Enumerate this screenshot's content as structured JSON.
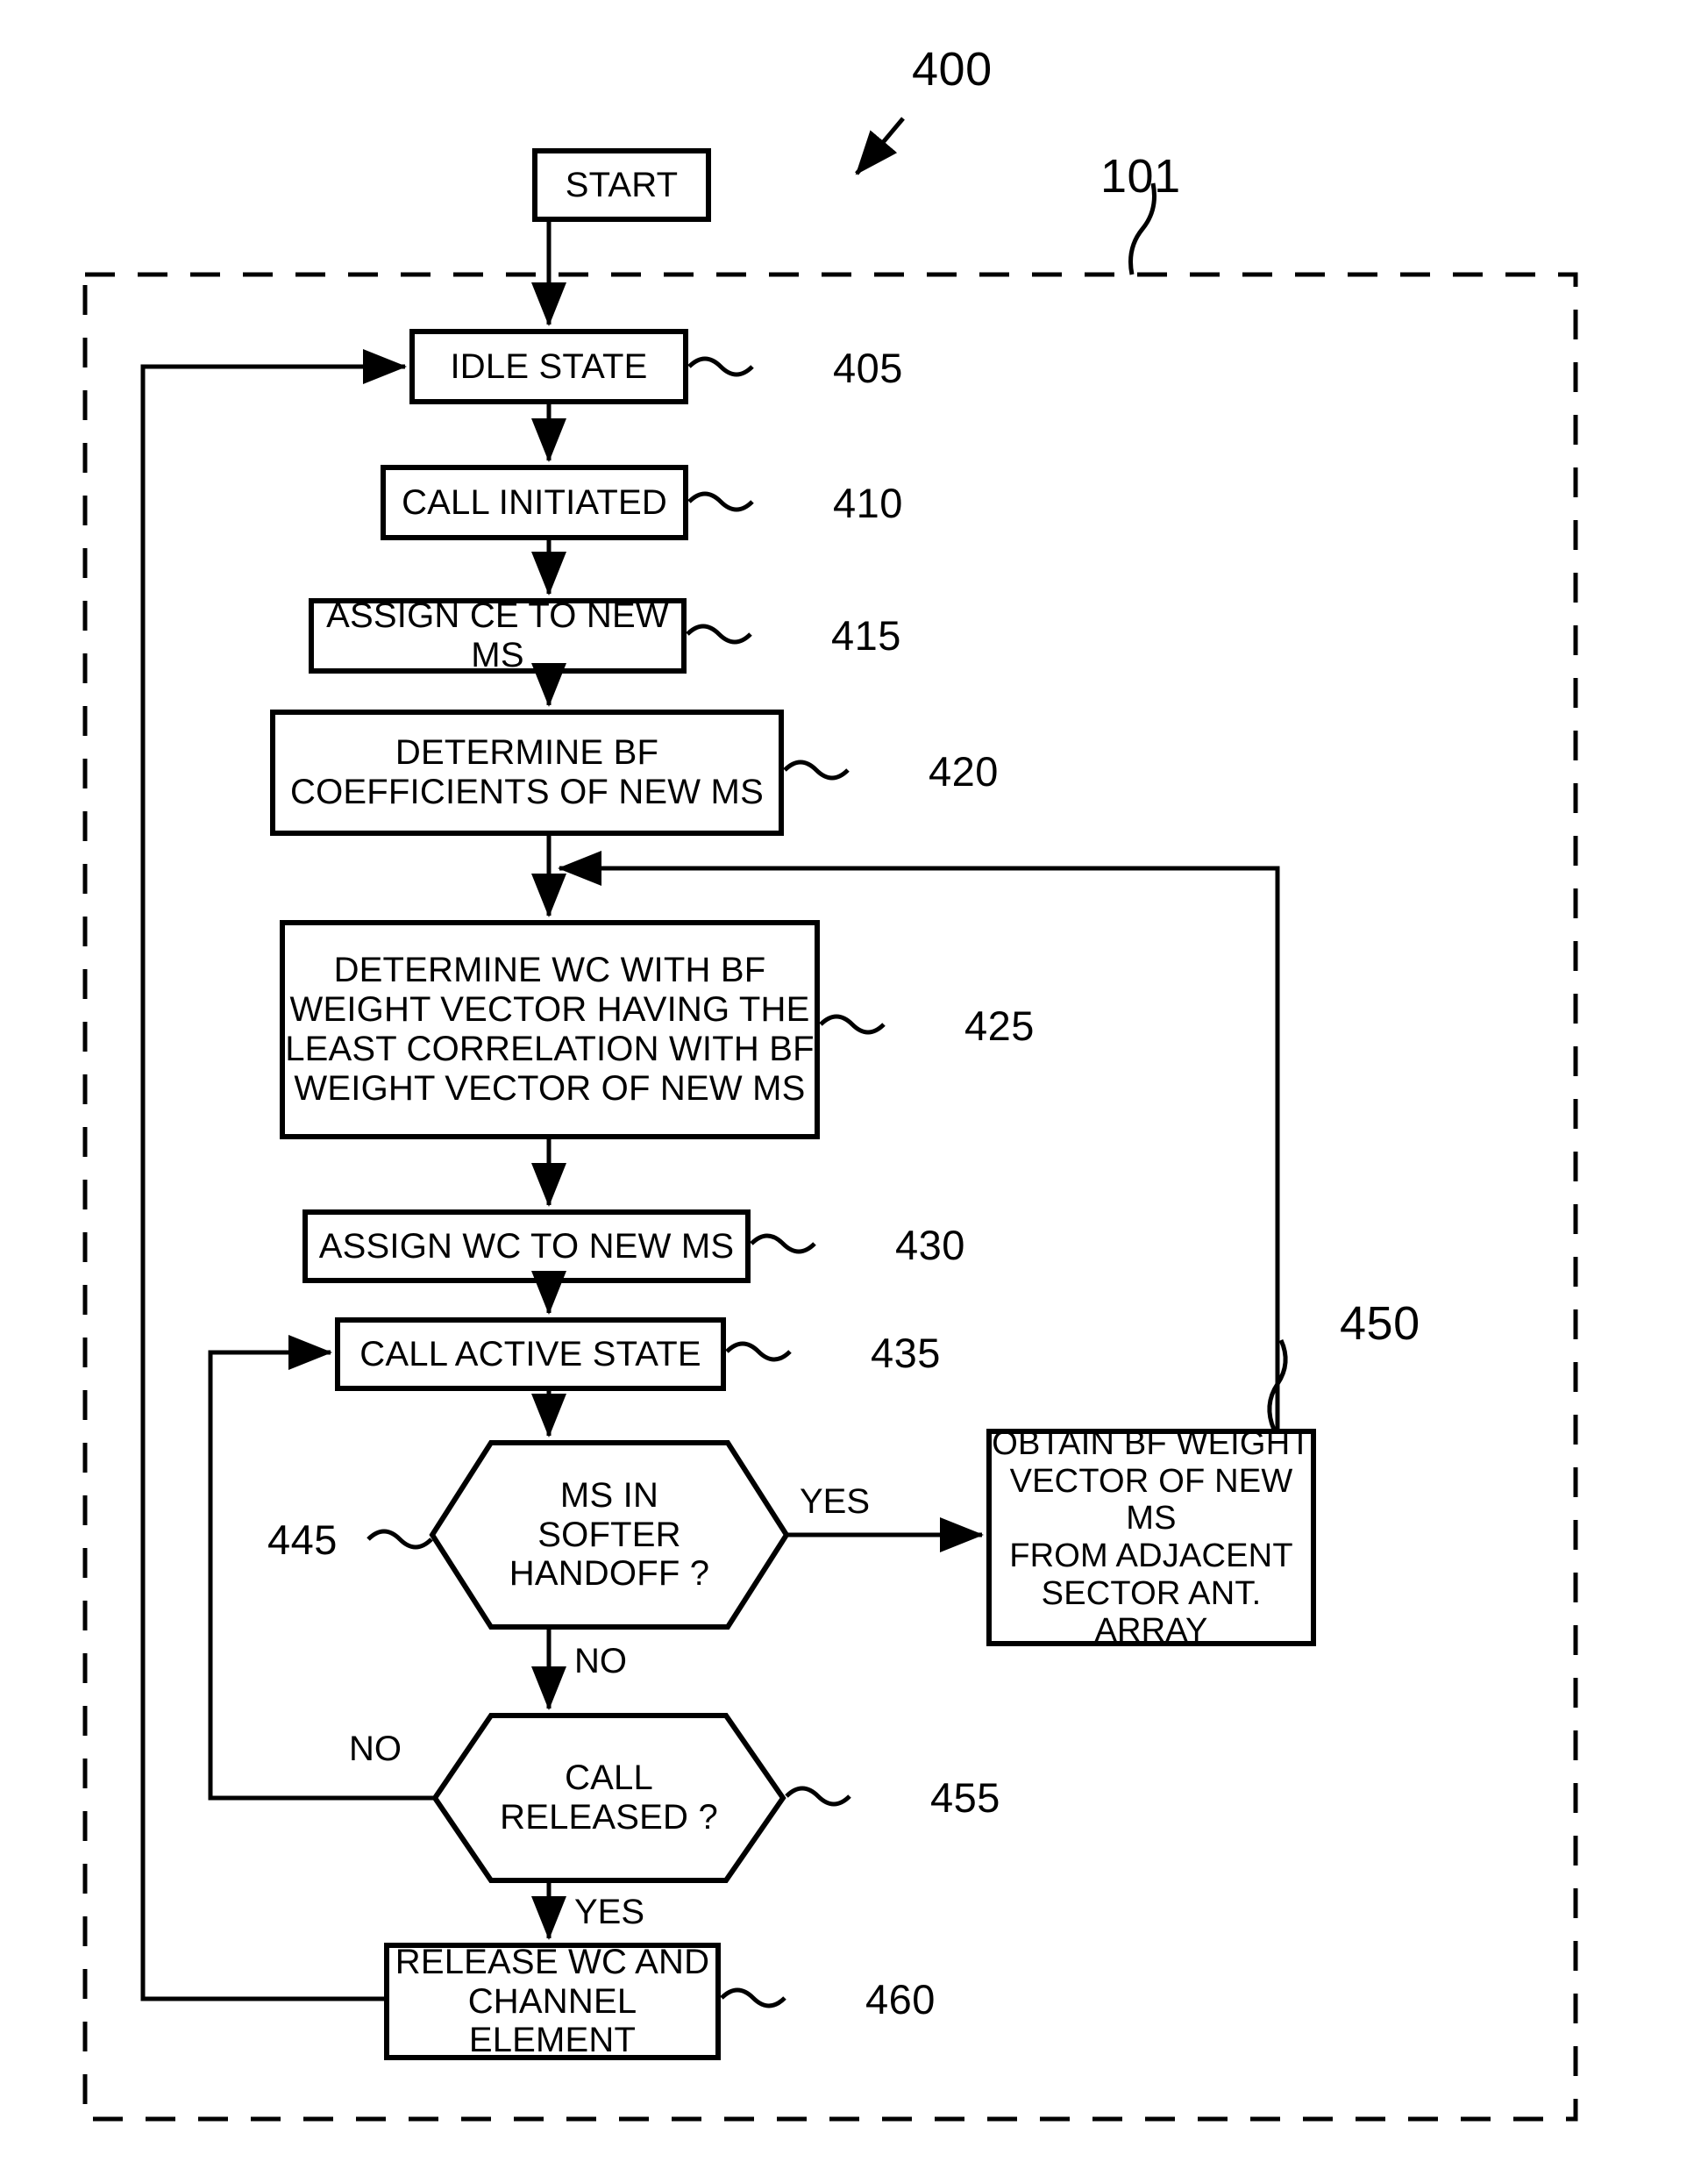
{
  "figure": {
    "figure_number": "400",
    "enclosure_ref": "101"
  },
  "nodes": [
    {
      "id": "start",
      "label": "START",
      "shape": "rect",
      "ref": ""
    },
    {
      "id": "idle",
      "label": "IDLE STATE",
      "shape": "rect",
      "ref": "405"
    },
    {
      "id": "call_init",
      "label": "CALL INITIATED",
      "shape": "rect",
      "ref": "410"
    },
    {
      "id": "assign_ce",
      "label": "ASSIGN CE TO NEW MS",
      "shape": "rect",
      "ref": "415"
    },
    {
      "id": "det_bf",
      "label": "DETERMINE BF\nCOEFFICIENTS OF NEW MS",
      "shape": "rect",
      "ref": "420"
    },
    {
      "id": "det_wc",
      "label": "DETERMINE WC WITH BF\nWEIGHT VECTOR HAVING THE\nLEAST CORRELATION WITH BF\nWEIGHT VECTOR OF NEW MS",
      "shape": "rect",
      "ref": "425"
    },
    {
      "id": "assign_wc",
      "label": "ASSIGN WC TO NEW MS",
      "shape": "rect",
      "ref": "430"
    },
    {
      "id": "call_active",
      "label": "CALL ACTIVE STATE",
      "shape": "rect",
      "ref": "435"
    },
    {
      "id": "softer_ho",
      "label": "MS IN\nSOFTER\nHANDOFF ?",
      "shape": "hexagon",
      "ref": "445"
    },
    {
      "id": "obtain_bf",
      "label": "OBTAIN BF WEIGHT\nVECTOR OF NEW MS\nFROM ADJACENT\nSECTOR ANT. ARRAY",
      "shape": "rect",
      "ref": "450"
    },
    {
      "id": "call_released",
      "label": "CALL\nRELEASED ?",
      "shape": "hexagon",
      "ref": "455"
    },
    {
      "id": "release_wc",
      "label": "RELEASE WC AND\nCHANNEL ELEMENT",
      "shape": "rect",
      "ref": "460"
    }
  ],
  "edge_labels": {
    "softer_handoff_yes": "YES",
    "softer_handoff_no": "NO",
    "call_released_no": "NO",
    "call_released_yes": "YES"
  },
  "colors": {
    "stroke": "#000000",
    "background": "#ffffff",
    "text": "#000000"
  }
}
